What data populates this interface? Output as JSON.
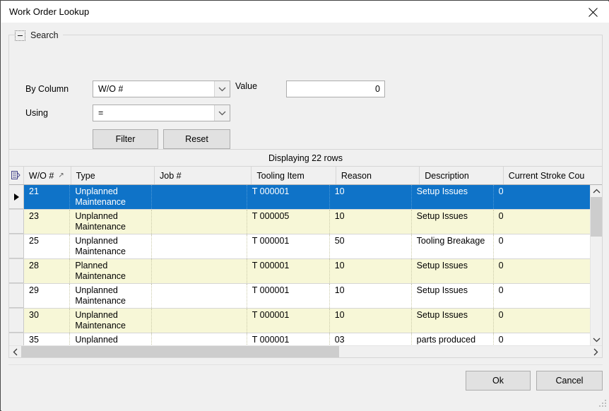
{
  "window": {
    "title": "Work Order Lookup",
    "close_icon": "close-icon"
  },
  "search_group": {
    "title": "Search",
    "expander_icon": "collapse-icon",
    "by_column_label": "By Column",
    "by_column_value": "W/O #",
    "using_label": "Using",
    "using_value": "=",
    "value_label": "Value",
    "value_input": "0",
    "filter_button": "Filter",
    "reset_button": "Reset"
  },
  "grid": {
    "caption": "Displaying 22 rows",
    "sort_indicator": "↗",
    "columns": [
      {
        "key": "wo",
        "label": "W/O #",
        "sorted": true
      },
      {
        "key": "type",
        "label": "Type",
        "sorted": false
      },
      {
        "key": "job",
        "label": "Job #",
        "sorted": false
      },
      {
        "key": "tool",
        "label": "Tooling Item",
        "sorted": false
      },
      {
        "key": "reas",
        "label": "Reason",
        "sorted": false
      },
      {
        "key": "desc",
        "label": "Description",
        "sorted": false
      },
      {
        "key": "strk",
        "label": "Current Stroke Cou",
        "sorted": false
      }
    ],
    "rows": [
      {
        "wo": "21",
        "type": "Unplanned\nMaintenance",
        "job": "",
        "tool": "T 000001",
        "reas": "10",
        "desc": "Setup Issues",
        "strk": "0",
        "selected": true,
        "alt": false
      },
      {
        "wo": "23",
        "type": "Unplanned\nMaintenance",
        "job": "",
        "tool": "T 000005",
        "reas": "10",
        "desc": "Setup Issues",
        "strk": "0",
        "selected": false,
        "alt": true
      },
      {
        "wo": "25",
        "type": "Unplanned\nMaintenance",
        "job": "",
        "tool": "T 000001",
        "reas": "50",
        "desc": "Tooling Breakage",
        "strk": "0",
        "selected": false,
        "alt": false
      },
      {
        "wo": "28",
        "type": "Planned\nMaintenance",
        "job": "",
        "tool": "T 000001",
        "reas": "10",
        "desc": "Setup Issues",
        "strk": "0",
        "selected": false,
        "alt": true
      },
      {
        "wo": "29",
        "type": "Unplanned\nMaintenance",
        "job": "",
        "tool": "T 000001",
        "reas": "10",
        "desc": "Setup Issues",
        "strk": "0",
        "selected": false,
        "alt": false
      },
      {
        "wo": "30",
        "type": "Unplanned\nMaintenance",
        "job": "",
        "tool": "T 000001",
        "reas": "10",
        "desc": "Setup Issues",
        "strk": "0",
        "selected": false,
        "alt": true
      },
      {
        "wo": "35",
        "type": "Unplanned\nMaintenance",
        "job": "",
        "tool": "T 000001",
        "reas": "03",
        "desc": "parts produced",
        "strk": "0",
        "selected": false,
        "alt": false
      }
    ]
  },
  "footer": {
    "ok_button": "Ok",
    "cancel_button": "Cancel"
  },
  "colors": {
    "selection": "#0f73c8",
    "alt_row": "#f7f7d7",
    "chrome": "#f0f0f0",
    "button_face": "#e1e1e1"
  }
}
